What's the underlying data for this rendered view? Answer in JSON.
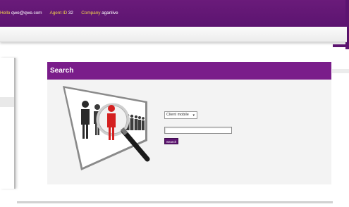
{
  "topbar": {
    "hello_label": "Hello",
    "email": "qwe@qwe.com",
    "agent_label": "Agent ID",
    "agent_id": "32",
    "company_label": "Company",
    "company": "aganlive"
  },
  "search_panel": {
    "title": "Search",
    "filter_selected": "Client mobile",
    "filter_caret": "▾",
    "query_value": "",
    "search_button_label": "Search"
  },
  "colors": {
    "brand_purple": "#6a1b7a",
    "header_purple": "#7a1d8a",
    "label_yellow": "#f0d34a",
    "highlight_red": "#d42020"
  },
  "icons": [
    "magnifying-glass-icon",
    "people-figures-icon",
    "dropdown-caret-icon"
  ]
}
